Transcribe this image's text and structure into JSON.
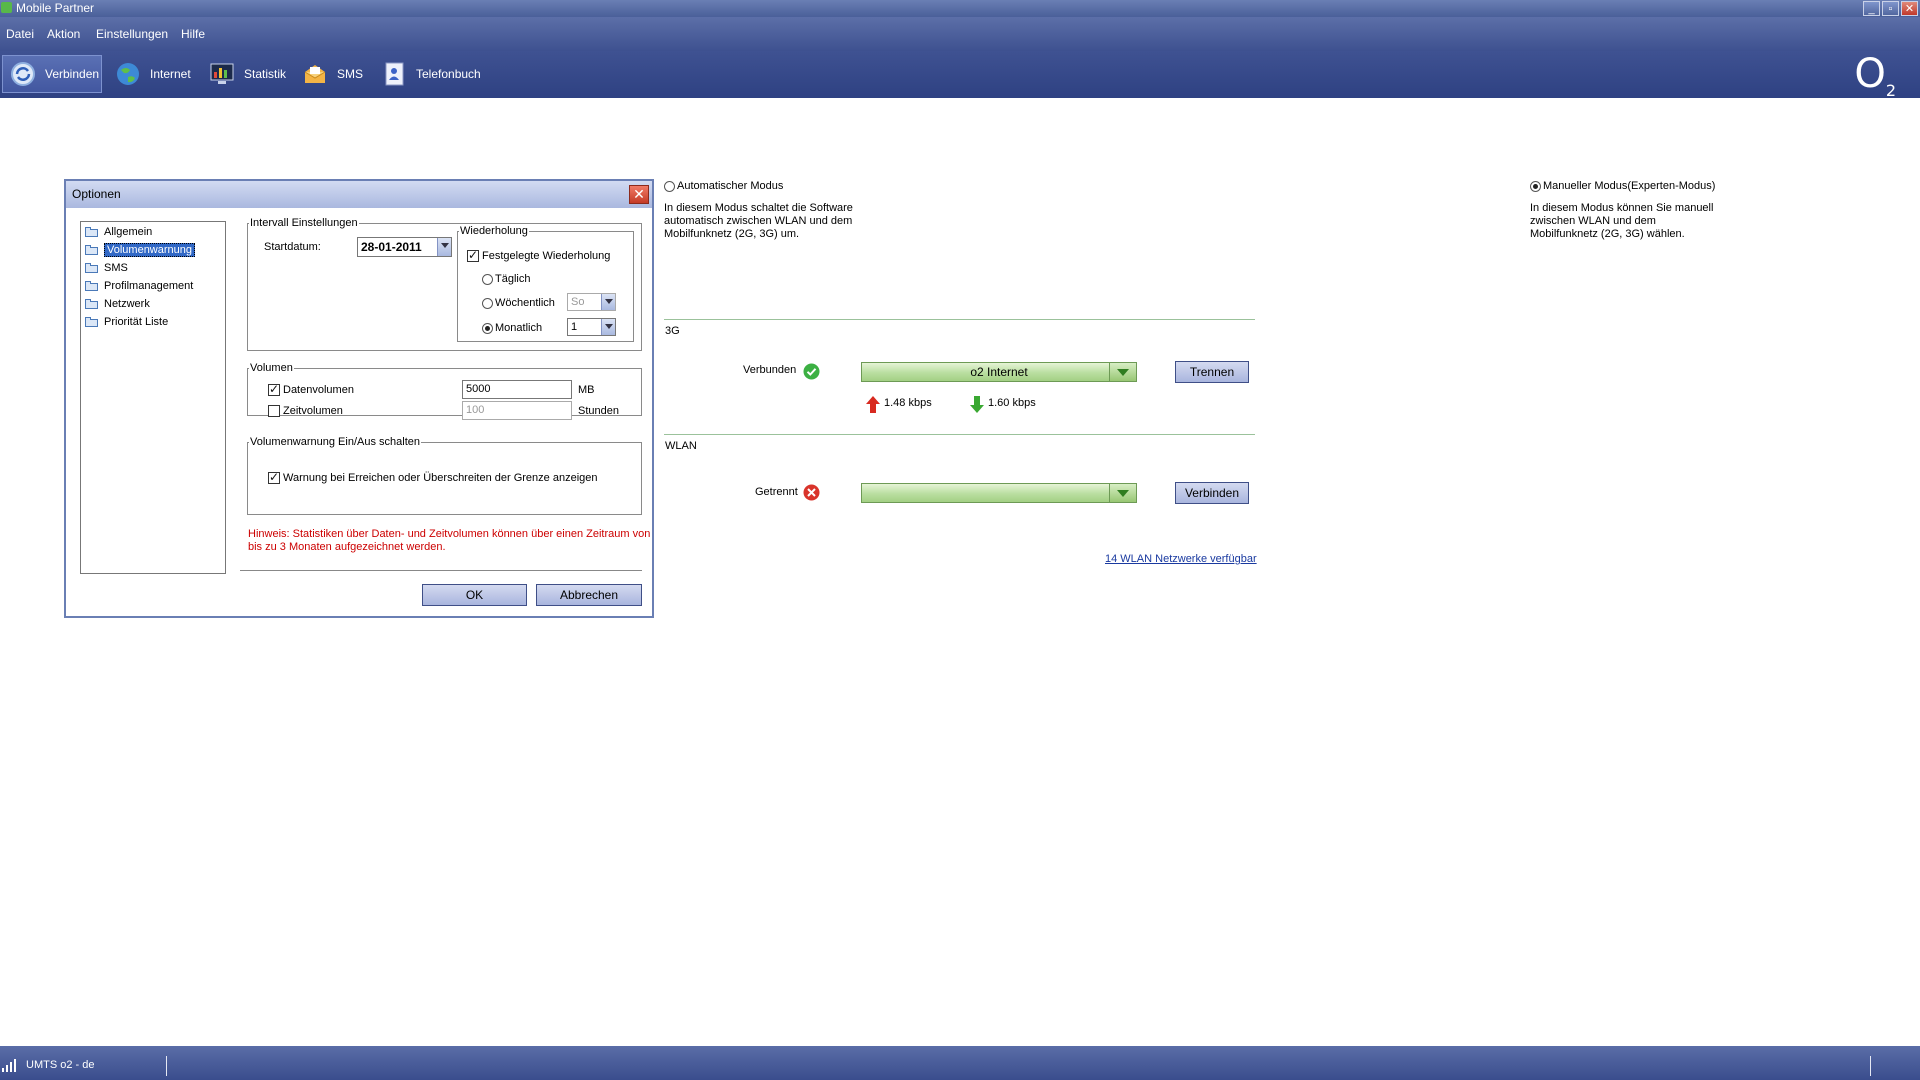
{
  "window": {
    "title": "Mobile Partner",
    "minimize": "_",
    "maximize": "▫",
    "close": "✕"
  },
  "menu": [
    "Datei",
    "Aktion",
    "Einstellungen",
    "Hilfe"
  ],
  "toolbar": {
    "items": [
      "Verbinden",
      "Internet",
      "Statistik",
      "SMS",
      "Telefonbuch"
    ],
    "logo": "O",
    "logo_sub": "2"
  },
  "modes": {
    "auto_label": "Automatischer Modus",
    "auto_desc": [
      "In diesem Modus schaltet die Software",
      "automatisch zwischen WLAN und dem",
      "Mobilfunknetz (2G, 3G) um."
    ],
    "manual_label": "Manueller Modus(Experten-Modus)",
    "manual_desc": [
      "In diesem Modus können Sie manuell",
      "zwischen WLAN und dem",
      "Mobilfunknetz (2G, 3G) wählen."
    ],
    "selected": "manual"
  },
  "g3": {
    "section": "3G",
    "status": "Verbunden",
    "profile": "o2 Internet",
    "button": "Trennen",
    "upload": "1.48 kbps",
    "download": "1.60 kbps"
  },
  "wlan": {
    "section": "WLAN",
    "status": "Getrennt",
    "profile": "",
    "button": "Verbinden",
    "networks_link": "14 WLAN Netzwerke verfügbar"
  },
  "dialog": {
    "title": "Optionen",
    "tree": [
      "Allgemein",
      "Volumenwarnung",
      "SMS",
      "Profilmanagement",
      "Netzwerk",
      "Priorität Liste"
    ],
    "selected_tree": "Volumenwarnung",
    "interval": {
      "legend": "Intervall Einstellungen",
      "start_label": "Startdatum:",
      "start_value": "28-01-2011"
    },
    "repeat": {
      "legend": "Wiederholung",
      "fixed_label": "Festgelegte Wiederholung",
      "fixed_checked": true,
      "daily": "Täglich",
      "weekly": "Wöchentlich",
      "weekly_value": "So",
      "monthly": "Monatlich",
      "monthly_value": "1",
      "selected": "monthly"
    },
    "volume": {
      "legend": "Volumen",
      "data_label": "Datenvolumen",
      "data_checked": true,
      "data_value": "5000",
      "data_unit": "MB",
      "time_label": "Zeitvolumen",
      "time_checked": false,
      "time_value": "100",
      "time_unit": "Stunden"
    },
    "warning": {
      "legend": "Volumenwarnung Ein/Aus schalten",
      "label": "Warnung bei Erreichen oder Überschreiten der Grenze anzeigen",
      "checked": true
    },
    "hint": [
      "Hinweis: Statistiken über Daten- und Zeitvolumen können über einen Zeitraum von",
      "bis zu 3 Monaten aufgezeichnet werden."
    ],
    "ok": "OK",
    "cancel": "Abbrechen"
  },
  "statusbar": {
    "network": "UMTS  o2 - de"
  },
  "colors": {
    "title_bar": "#4a5f99",
    "toolbar": "#2e4182",
    "hint_red": "#cc0000",
    "ok_green": "#3cb043",
    "error_red": "#d9342b"
  }
}
